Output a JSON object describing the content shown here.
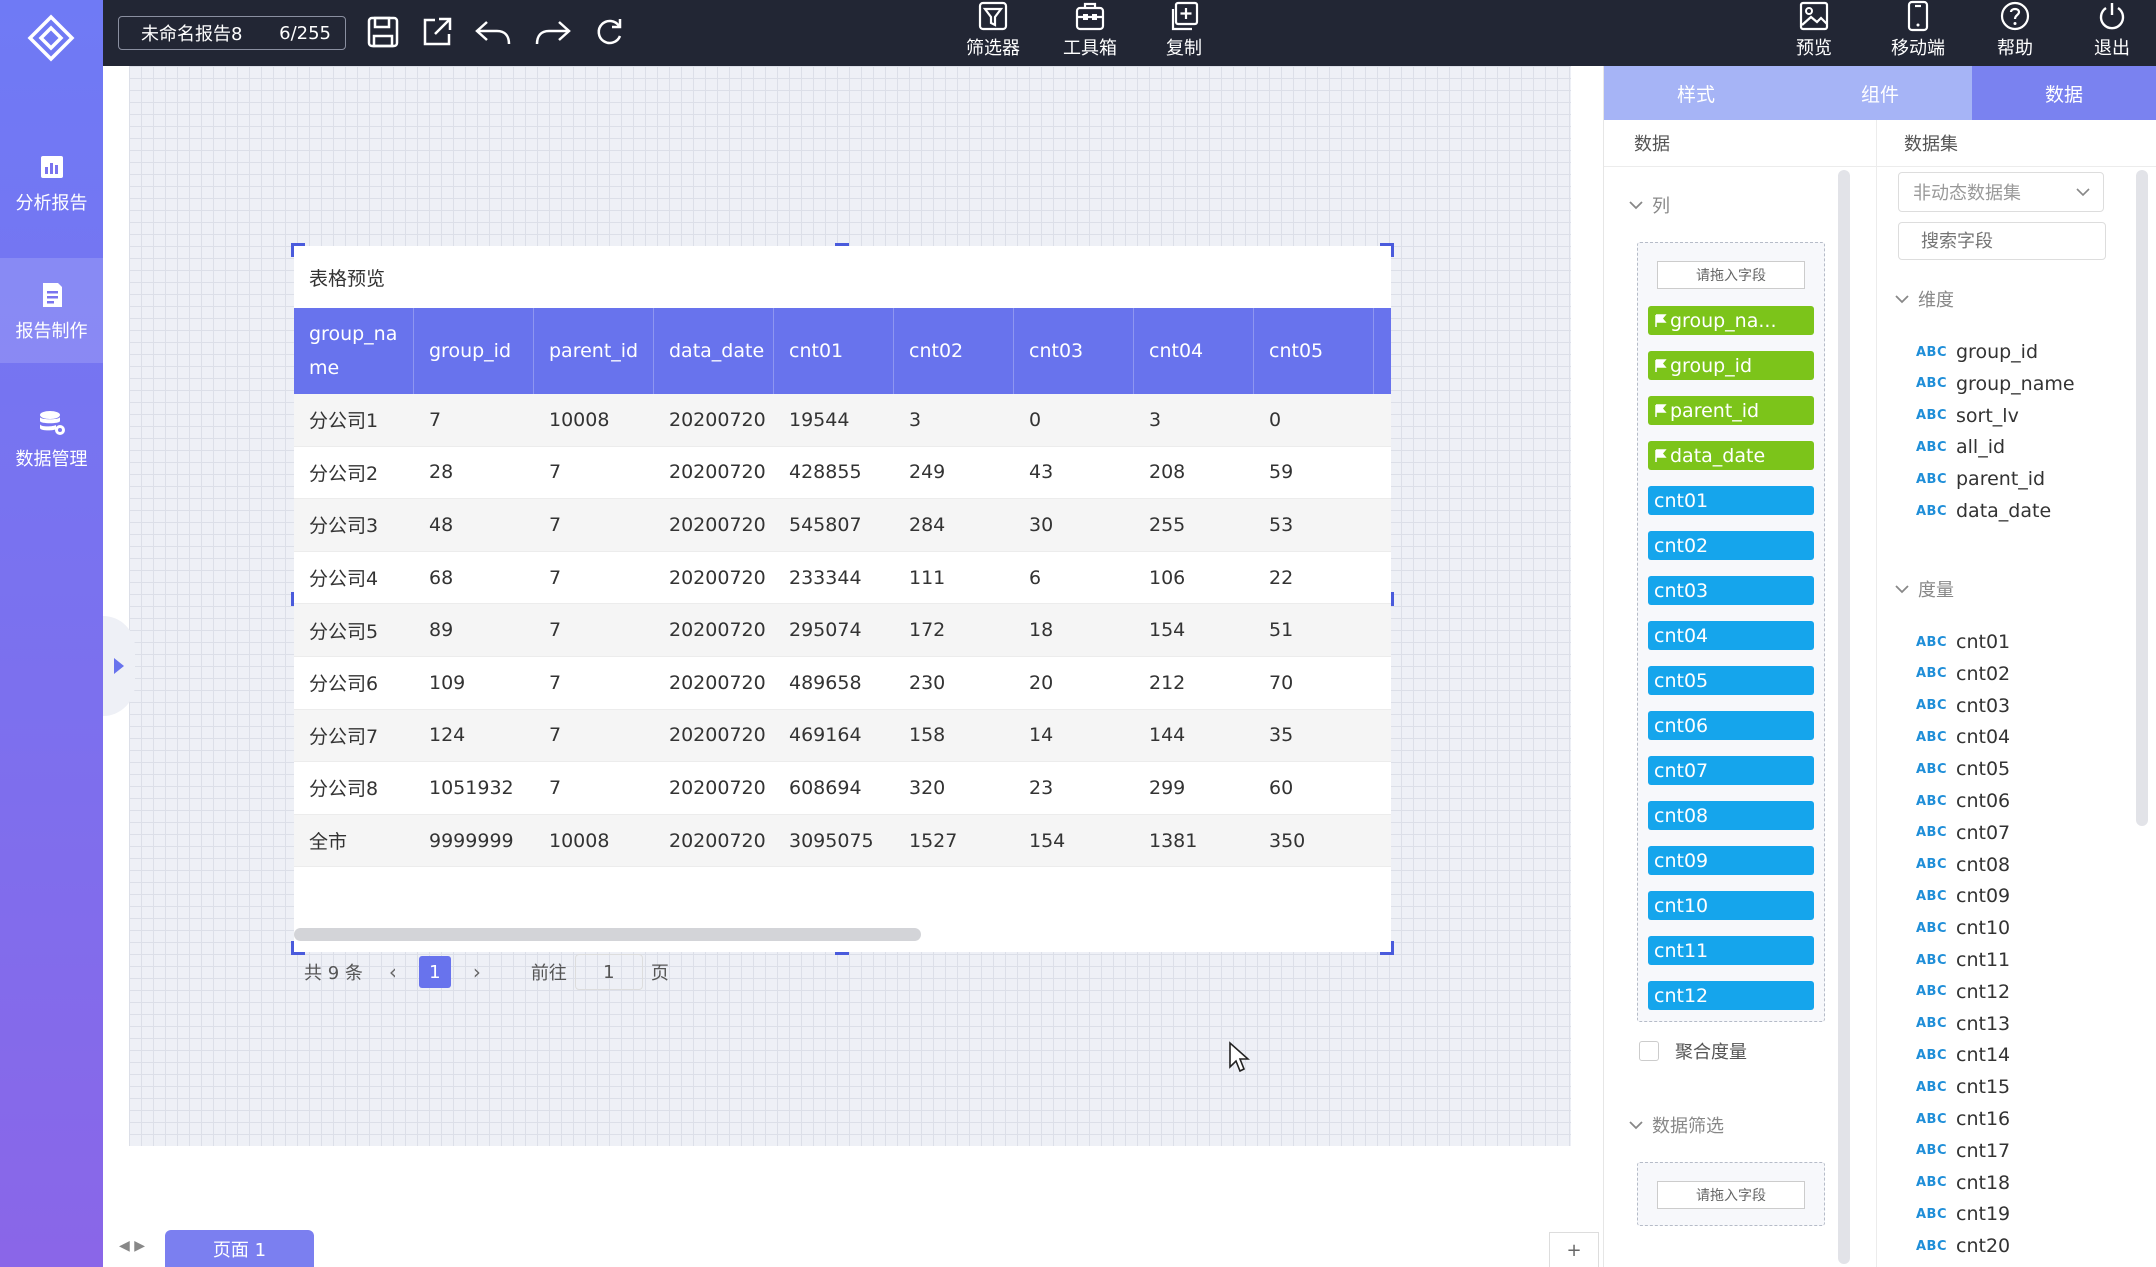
{
  "nav": {
    "items": [
      {
        "label": "分析报告",
        "icon": "chart-report-icon"
      },
      {
        "label": "报告制作",
        "icon": "report-edit-icon"
      },
      {
        "label": "数据管理",
        "icon": "database-gear-icon"
      }
    ]
  },
  "topbar": {
    "report_name": "未命名报告8",
    "page_count": "6/255",
    "filter_label": "筛选器",
    "toolbox_label": "工具箱",
    "copy_label": "复制",
    "preview_label": "预览",
    "mobile_label": "移动端",
    "help_label": "帮助",
    "exit_label": "退出"
  },
  "widget": {
    "title": "表格预览",
    "columns": [
      "group_name",
      "group_id",
      "parent_id",
      "data_date",
      "cnt01",
      "cnt02",
      "cnt03",
      "cnt04",
      "cnt05"
    ],
    "rows": [
      [
        "分公司1",
        "7",
        "10008",
        "20200720",
        "19544",
        "3",
        "0",
        "3",
        "0"
      ],
      [
        "分公司2",
        "28",
        "7",
        "20200720",
        "428855",
        "249",
        "43",
        "208",
        "59"
      ],
      [
        "分公司3",
        "48",
        "7",
        "20200720",
        "545807",
        "284",
        "30",
        "255",
        "53"
      ],
      [
        "分公司4",
        "68",
        "7",
        "20200720",
        "233344",
        "111",
        "6",
        "106",
        "22"
      ],
      [
        "分公司5",
        "89",
        "7",
        "20200720",
        "295074",
        "172",
        "18",
        "154",
        "51"
      ],
      [
        "分公司6",
        "109",
        "7",
        "20200720",
        "489658",
        "230",
        "20",
        "212",
        "70"
      ],
      [
        "分公司7",
        "124",
        "7",
        "20200720",
        "469164",
        "158",
        "14",
        "144",
        "35"
      ],
      [
        "分公司8",
        "1051932",
        "7",
        "20200720",
        "608694",
        "320",
        "23",
        "299",
        "60"
      ],
      [
        "全市",
        "9999999",
        "10008",
        "20200720",
        "3095075",
        "1527",
        "154",
        "1381",
        "350"
      ]
    ],
    "pager": {
      "total": "共 9 条",
      "current": "1",
      "goto_prefix": "前往",
      "goto_value": "1",
      "goto_suffix": "页"
    }
  },
  "pages": {
    "tab_label": "页面 1",
    "add": "+"
  },
  "panel": {
    "tabs": [
      "样式",
      "组件",
      "数据"
    ],
    "active_tab": "数据",
    "data_title": "数据",
    "columns_label": "列",
    "drop_hint": "请拖入字段",
    "column_chips": [
      {
        "label": "group_na...",
        "kind": "dimension"
      },
      {
        "label": "group_id",
        "kind": "dimension"
      },
      {
        "label": "parent_id",
        "kind": "dimension"
      },
      {
        "label": "data_date",
        "kind": "dimension"
      },
      {
        "label": "cnt01",
        "kind": "measure"
      },
      {
        "label": "cnt02",
        "kind": "measure"
      },
      {
        "label": "cnt03",
        "kind": "measure"
      },
      {
        "label": "cnt04",
        "kind": "measure"
      },
      {
        "label": "cnt05",
        "kind": "measure"
      },
      {
        "label": "cnt06",
        "kind": "measure"
      },
      {
        "label": "cnt07",
        "kind": "measure"
      },
      {
        "label": "cnt08",
        "kind": "measure"
      },
      {
        "label": "cnt09",
        "kind": "measure"
      },
      {
        "label": "cnt10",
        "kind": "measure"
      },
      {
        "label": "cnt11",
        "kind": "measure"
      },
      {
        "label": "cnt12",
        "kind": "measure"
      }
    ],
    "aggregate_label": "聚合度量",
    "filter_label": "数据筛选",
    "dataset_title": "数据集",
    "dataset_select": "非动态数据集",
    "search_placeholder": "搜索字段",
    "dimension_label": "维度",
    "dimensions": [
      "group_id",
      "group_name",
      "sort_lv",
      "all_id",
      "parent_id",
      "data_date"
    ],
    "measure_label": "度量",
    "measures": [
      "cnt01",
      "cnt02",
      "cnt03",
      "cnt04",
      "cnt05",
      "cnt06",
      "cnt07",
      "cnt08",
      "cnt09",
      "cnt10",
      "cnt11",
      "cnt12",
      "cnt13",
      "cnt14",
      "cnt15",
      "cnt16",
      "cnt17",
      "cnt18",
      "cnt19",
      "cnt20"
    ],
    "field_type": "ABC"
  },
  "colors": {
    "accent": "#6873ed",
    "topbar": "#222634",
    "dimension": "#7cc41a",
    "measure": "#15a5ec"
  }
}
